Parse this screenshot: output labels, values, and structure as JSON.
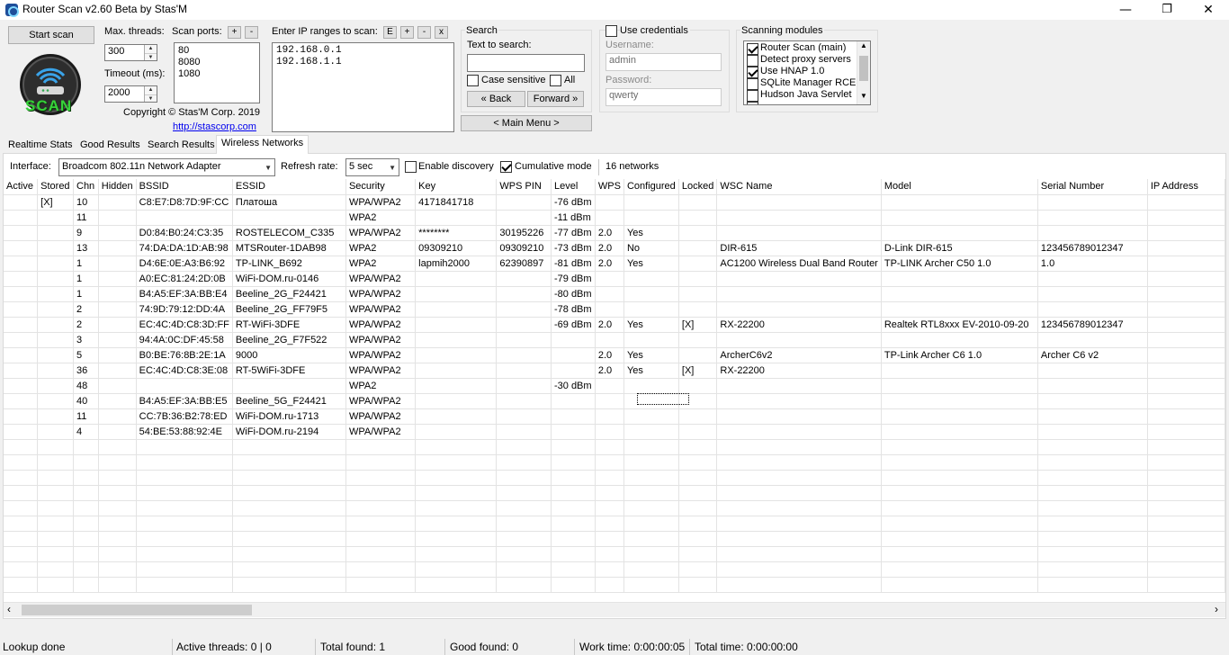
{
  "window": {
    "title": "Router Scan v2.60 Beta by Stas'M",
    "minimize_glyph": "—",
    "maximize_glyph": "❐",
    "close_glyph": "✕"
  },
  "controls": {
    "start_scan": "Start scan",
    "max_threads_label": "Max. threads:",
    "max_threads_value": "300",
    "timeout_label": "Timeout (ms):",
    "timeout_value": "2000",
    "scan_ports_label": "Scan ports:",
    "ports": [
      "80",
      "8080",
      "1080"
    ],
    "copyright": "Copyright © Stas'M Corp. 2019",
    "link": "http://stascorp.com",
    "logo_text": "SCAN",
    "ip_label": "Enter IP ranges to scan:",
    "ip_ranges": [
      "192.168.0.1",
      "192.168.1.1"
    ],
    "small_buttons": {
      "plus": "+",
      "minus": "-",
      "e": "E",
      "x": "x"
    }
  },
  "search": {
    "group": "Search",
    "text_label": "Text to search:",
    "text_value": "",
    "case_sensitive": "Case sensitive",
    "all": "All",
    "back": "« Back",
    "forward": "Forward »",
    "main_menu": "< Main Menu >"
  },
  "credentials": {
    "use_label": "Use credentials",
    "username_label": "Username:",
    "username_value": "admin",
    "password_label": "Password:",
    "password_value": "qwerty"
  },
  "modules": {
    "title": "Scanning modules",
    "items": [
      {
        "label": "Router Scan (main)",
        "checked": true
      },
      {
        "label": "Detect proxy servers",
        "checked": false
      },
      {
        "label": "Use HNAP 1.0",
        "checked": true
      },
      {
        "label": "SQLite Manager RCE",
        "checked": false
      },
      {
        "label": "Hudson Java Servlet",
        "checked": false
      }
    ]
  },
  "tabs": [
    "Realtime Stats",
    "Good Results",
    "Search Results",
    "Wireless Networks"
  ],
  "active_tab": "Wireless Networks",
  "wireless": {
    "interface_label": "Interface:",
    "interface_value": "Broadcom 802.11n Network Adapter",
    "refresh_label": "Refresh rate:",
    "refresh_value": "5 sec",
    "enable_discovery": "Enable discovery",
    "cumulative_mode": "Cumulative mode",
    "network_count": "16 networks",
    "columns": [
      "Active",
      "Stored",
      "Chn",
      "Hidden",
      "BSSID",
      "ESSID",
      "Security",
      "Key",
      "WPS PIN",
      "Level",
      "WPS",
      "Configured",
      "Locked",
      "WSC Name",
      "Model",
      "Serial Number",
      "IP Address"
    ],
    "rows": [
      [
        "",
        "[X]",
        "10",
        "",
        "C8:E7:D8:7D:9F:CC",
        "Платоша",
        "WPA/WPA2",
        "4171841718",
        "",
        "-76 dBm",
        "",
        "",
        "",
        "",
        "",
        "",
        ""
      ],
      [
        "",
        "",
        "11",
        "",
        "",
        "",
        "WPA2",
        "",
        "",
        "-11 dBm",
        "",
        "",
        "",
        "",
        "",
        "",
        ""
      ],
      [
        "",
        "",
        "9",
        "",
        "D0:84:B0:24:C3:35",
        "ROSTELECOM_C335",
        "WPA/WPA2",
        "********",
        "30195226",
        "-77 dBm",
        "2.0",
        "Yes",
        "",
        "",
        "",
        "",
        ""
      ],
      [
        "",
        "",
        "13",
        "",
        "74:DA:DA:1D:AB:98",
        "MTSRouter-1DAB98",
        "WPA2",
        "09309210",
        "09309210",
        "-73 dBm",
        "2.0",
        "No",
        "",
        "DIR-615",
        "D-Link DIR-615",
        "123456789012347",
        ""
      ],
      [
        "",
        "",
        "1",
        "",
        "D4:6E:0E:A3:B6:92",
        "TP-LINK_B692",
        "WPA2",
        "lapmih2000",
        "62390897",
        "-81 dBm",
        "2.0",
        "Yes",
        "",
        "AC1200 Wireless Dual Band Router",
        "TP-LINK Archer C50 1.0",
        "1.0",
        ""
      ],
      [
        "",
        "",
        "1",
        "",
        "A0:EC:81:24:2D:0B",
        "WiFi-DOM.ru-0146",
        "WPA/WPA2",
        "",
        "",
        "-79 dBm",
        "",
        "",
        "",
        "",
        "",
        "",
        ""
      ],
      [
        "",
        "",
        "1",
        "",
        "B4:A5:EF:3A:BB:E4",
        "Beeline_2G_F24421",
        "WPA/WPA2",
        "",
        "",
        "-80 dBm",
        "",
        "",
        "",
        "",
        "",
        "",
        ""
      ],
      [
        "",
        "",
        "2",
        "",
        "74:9D:79:12:DD:4A",
        "Beeline_2G_FF79F5",
        "WPA/WPA2",
        "",
        "",
        "-78 dBm",
        "",
        "",
        "",
        "",
        "",
        "",
        ""
      ],
      [
        "",
        "",
        "2",
        "",
        "EC:4C:4D:C8:3D:FF",
        "RT-WiFi-3DFE",
        "WPA/WPA2",
        "",
        "",
        "-69 dBm",
        "2.0",
        "Yes",
        "[X]",
        "RX-22200",
        "Realtek RTL8xxx EV-2010-09-20",
        "123456789012347",
        ""
      ],
      [
        "",
        "",
        "3",
        "",
        "94:4A:0C:DF:45:58",
        "Beeline_2G_F7F522",
        "WPA/WPA2",
        "",
        "",
        "",
        "",
        "",
        "",
        "",
        "",
        "",
        ""
      ],
      [
        "",
        "",
        "5",
        "",
        "B0:BE:76:8B:2E:1A",
        "9000",
        "WPA/WPA2",
        "",
        "",
        "",
        "2.0",
        "Yes",
        "",
        "ArcherC6v2",
        "TP-Link Archer C6 1.0",
        "Archer C6 v2",
        ""
      ],
      [
        "",
        "",
        "36",
        "",
        "EC:4C:4D:C8:3E:08",
        "RT-5WiFi-3DFE",
        "WPA/WPA2",
        "",
        "",
        "",
        "2.0",
        "Yes",
        "[X]",
        "RX-22200",
        "",
        "",
        ""
      ],
      [
        "",
        "",
        "48",
        "",
        "",
        "",
        "WPA2",
        "",
        "",
        "-30 dBm",
        "",
        "",
        "",
        "",
        "",
        "",
        ""
      ],
      [
        "",
        "",
        "40",
        "",
        "B4:A5:EF:3A:BB:E5",
        "Beeline_5G_F24421",
        "WPA/WPA2",
        "",
        "",
        "",
        "",
        "",
        "",
        "",
        "",
        "",
        ""
      ],
      [
        "",
        "",
        "11",
        "",
        "CC:7B:36:B2:78:ED",
        "WiFi-DOM.ru-1713",
        "WPA/WPA2",
        "",
        "",
        "",
        "",
        "",
        "",
        "",
        "",
        "",
        ""
      ],
      [
        "",
        "",
        "4",
        "",
        "54:BE:53:88:92:4E",
        "WiFi-DOM.ru-2194",
        "WPA/WPA2",
        "",
        "",
        "",
        "",
        "",
        "",
        "",
        "",
        "",
        ""
      ]
    ]
  },
  "status": {
    "lookup": "Lookup done",
    "active_threads": "Active threads: 0 | 0",
    "total_found": "Total found: 1",
    "good_found": "Good found: 0",
    "work_time": "Work time: 0:00:00:05",
    "total_time": "Total time: 0:00:00:00"
  },
  "icons": {
    "scroll_left": "‹",
    "scroll_right": "›",
    "dropdown": "▼"
  }
}
